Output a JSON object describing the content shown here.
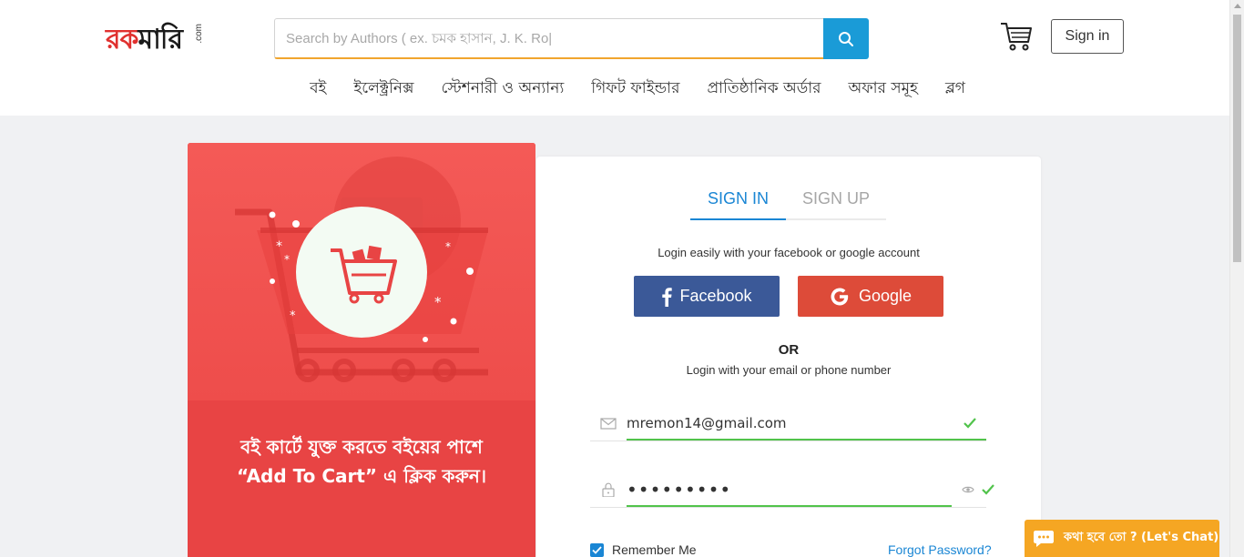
{
  "header": {
    "logo_text_red": "রক",
    "logo_text_dark": "মারি",
    "logo_suffix": ".com",
    "search_placeholder": "Search by Authors ( ex. চমক হাসান, J. K. Ro|",
    "signin_label": "Sign in"
  },
  "nav": {
    "items": [
      {
        "label": "বই"
      },
      {
        "label": "ইলেক্ট্রনিক্স"
      },
      {
        "label": "স্টেশনারী ও অন্যান্য"
      },
      {
        "label": "গিফট ফাইন্ডার"
      },
      {
        "label": "প্রাতিষ্ঠানিক অর্ডার"
      },
      {
        "label": "অফার সমূহ"
      },
      {
        "label": "ব্লগ"
      }
    ]
  },
  "promo": {
    "line1": "বই কার্টে যুক্ত করতে বইয়ের পাশে",
    "line2": "“Add To Cart” এ ক্লিক করুন।"
  },
  "login": {
    "tab_signin": "SIGN IN",
    "tab_signup": "SIGN UP",
    "social_text": "Login easily with your facebook or google account",
    "facebook_label": "Facebook",
    "google_label": "Google",
    "or_text": "OR",
    "email_text": "Login with your email or phone number",
    "email_value": "mremon14@gmail.com",
    "password_value": "•••••••••",
    "remember_label": "Remember Me",
    "forgot_label": "Forgot Password?"
  },
  "chat": {
    "label": "কথা হবে তো ? (Let's Chat)"
  },
  "colors": {
    "accent_blue": "#1a86d4",
    "search_blue": "#1a9bd7",
    "facebook": "#3b5998",
    "google": "#dd4b39",
    "promo_red": "#e84444",
    "chat_orange": "#f5a623",
    "valid_green": "#51c34b"
  }
}
